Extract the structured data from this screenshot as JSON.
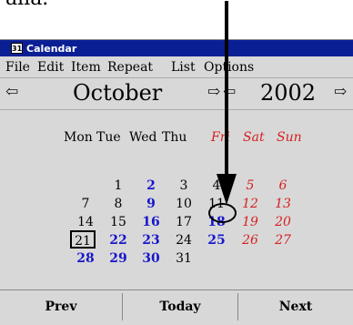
{
  "above_text": "alia.",
  "window": {
    "title": "Calendar",
    "icon_text": "31"
  },
  "menubar": [
    "File",
    "Edit",
    "Item",
    "Repeat",
    "List",
    "Options"
  ],
  "nav": {
    "month": "October",
    "year": "2002",
    "prev_month_icon": "arrow-left-icon",
    "next_month_icon": "arrow-right-icon"
  },
  "weekdays": [
    "Mon",
    "Tue",
    "Wed",
    "Thu",
    "Fri",
    "Sat",
    "Sun"
  ],
  "weeks": [
    [
      "",
      "1",
      "2",
      "3",
      "4",
      "5",
      "6"
    ],
    [
      "7",
      "8",
      "9",
      "10",
      "11",
      "12",
      "13"
    ],
    [
      "14",
      "15",
      "16",
      "17",
      "18",
      "19",
      "20"
    ],
    [
      "21",
      "22",
      "23",
      "24",
      "25",
      "26",
      "27"
    ],
    [
      "28",
      "29",
      "30",
      "31",
      "",
      "",
      ""
    ]
  ],
  "annotation": {
    "circled_day": "4",
    "pointer": "black arrow pointing to day 4"
  },
  "bottom_buttons": {
    "prev": "Prev",
    "today": "Today",
    "next": "Next"
  }
}
